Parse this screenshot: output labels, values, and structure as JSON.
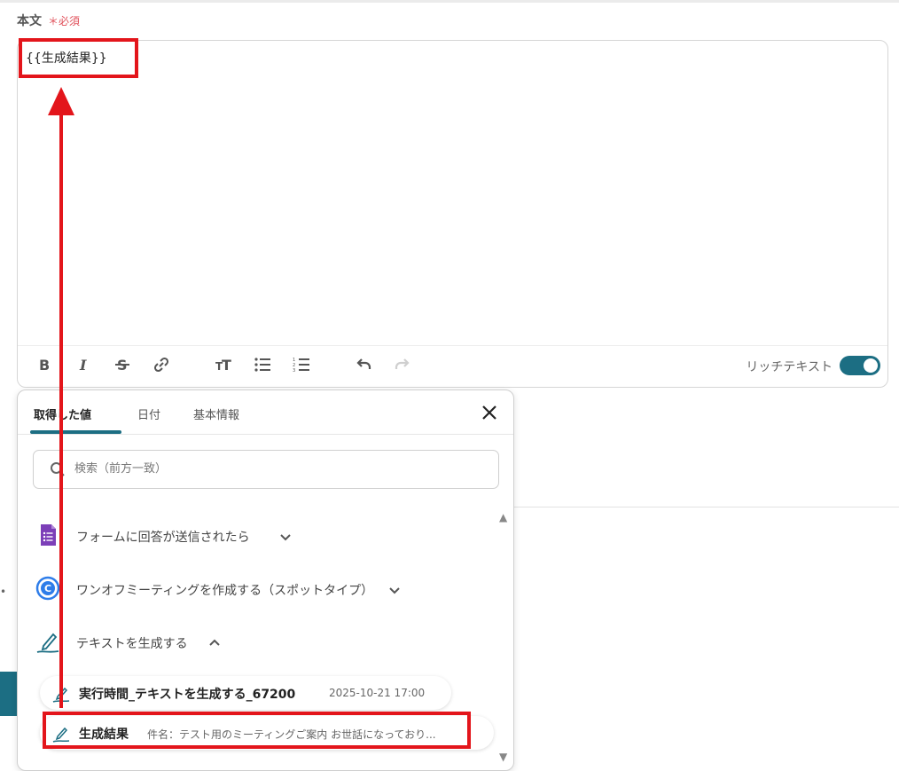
{
  "field": {
    "label": "本文",
    "required_mark": "＊",
    "required_text": "必須",
    "content": "{{生成結果}}"
  },
  "toolbar": {
    "buttons": [
      "bold-icon",
      "italic-icon",
      "strikethrough-icon",
      "link-icon",
      "text-size-icon",
      "bullet-list-icon",
      "numbered-list-icon",
      "undo-icon",
      "redo-icon"
    ],
    "rich_text_label": "リッチテキスト",
    "rich_text_enabled": true
  },
  "popup": {
    "tabs": [
      {
        "label": "取得した値",
        "active": true
      },
      {
        "label": "日付",
        "active": false
      },
      {
        "label": "基本情報",
        "active": false
      }
    ],
    "search": {
      "placeholder": "検索（前方一致）",
      "value": ""
    },
    "sections": [
      {
        "label": "フォームに回答が送信されたら",
        "icon": "google-forms-icon",
        "expanded": false
      },
      {
        "label": "ワンオフミーティングを作成する（スポットタイプ）",
        "icon": "calendar-app-icon",
        "expanded": false
      },
      {
        "label": "テキストを生成する",
        "icon": "ai-pen-icon",
        "expanded": true
      }
    ],
    "items": [
      {
        "label": "実行時間_テキストを生成する_67200",
        "value": "2025-10-21 17:00"
      },
      {
        "label": "生成結果",
        "value": "件名：テスト用のミーティングご案内 お世話になっており..."
      }
    ]
  },
  "colors": {
    "accent": "#1c6e83",
    "annotation_red": "#e3151b",
    "required_red": "#e0505a"
  }
}
